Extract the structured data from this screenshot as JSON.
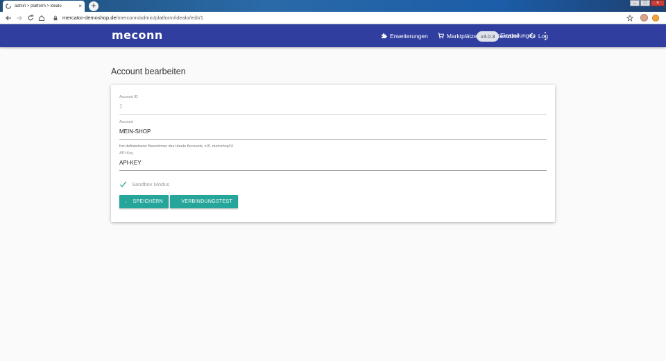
{
  "browser": {
    "tab_title": "admin > platform > idealo",
    "tab_close": "×",
    "new_tab": "+",
    "url_host": "mercator-demoshop.de",
    "url_path": "/merconn/admin/platform/idealo/edit/1",
    "window_controls": {
      "minimize": "–",
      "maximize": "□",
      "close": "×"
    }
  },
  "header": {
    "logo": "meconn",
    "nav": [
      {
        "label": "Erweiterungen",
        "icon": "puzzle-icon"
      },
      {
        "label": "Marktplätze",
        "icon": "cart-icon"
      },
      {
        "label": "Benutzer",
        "icon": "people-icon"
      },
      {
        "label": "Log",
        "icon": "history-icon"
      }
    ],
    "version": "v3.0.3",
    "settings_label": "Einstellungen",
    "accent_color": "#303f9f"
  },
  "page": {
    "title": "Account bearbeiten"
  },
  "form": {
    "account_id": {
      "label": "Account ID",
      "value": "1"
    },
    "account": {
      "label": "Account",
      "value": "MEIN-SHOP",
      "hint": "frei definierbarer Bezeichner des Idealo Accounts, z.B. meinshop24"
    },
    "api_key": {
      "label": "API Key",
      "value": "API-KEY"
    },
    "sandbox": {
      "label": "Sandbox Modus",
      "checked": true
    },
    "save_label": "SPEICHERN",
    "test_label": "VERBINDUNGSTEST",
    "button_color": "#26a69a"
  }
}
